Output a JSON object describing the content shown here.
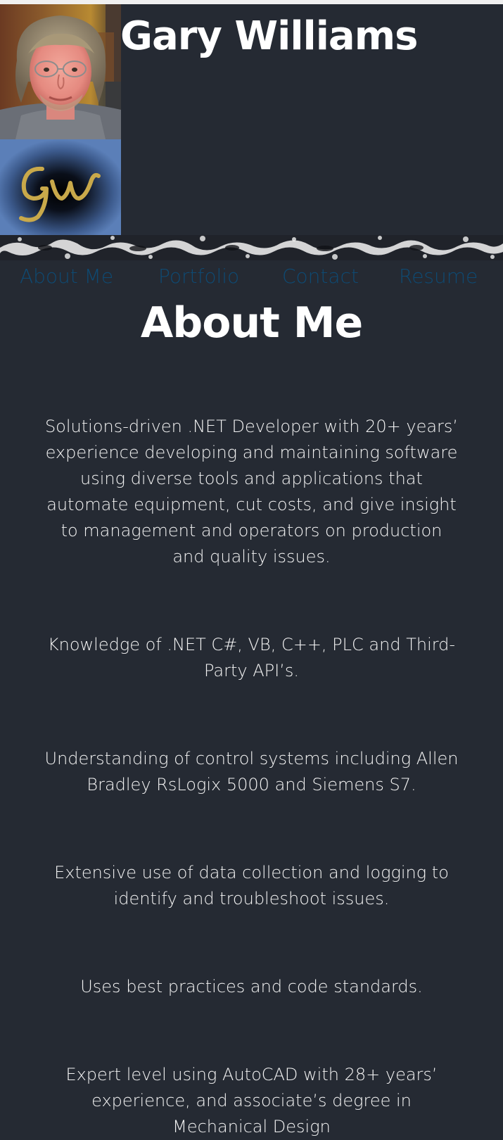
{
  "header": {
    "title": "Gary Williams",
    "monogram": "Gw",
    "portrait_alt": "Photo of Gary Williams"
  },
  "nav": {
    "items": [
      {
        "label": "About Me"
      },
      {
        "label": "Portfolio"
      },
      {
        "label": "Contact"
      },
      {
        "label": "Resume"
      }
    ],
    "link_color": "#0e4a73"
  },
  "main": {
    "heading": "About Me",
    "paragraphs": [
      "Solutions-driven .NET Developer with 20+ years’ experience developing and maintaining software using diverse tools and applications that automate equipment, cut costs, and give insight to management and operators on production and quality issues.",
      "Knowledge of .NET C#, VB, C++, PLC and Third-Party API’s.",
      "Understanding of control systems including Allen Bradley RsLogix 5000 and Siemens S7.",
      "Extensive use of data collection and logging to identify and troubleshoot issues.",
      "Uses best practices and code standards.",
      "Expert level using AutoCAD with 28+ years’ experience, and associate’s degree in Mechanical Design"
    ]
  },
  "colors": {
    "background": "#252a33",
    "text": "#ffffff",
    "monogram_gold": "#c9a94a"
  }
}
